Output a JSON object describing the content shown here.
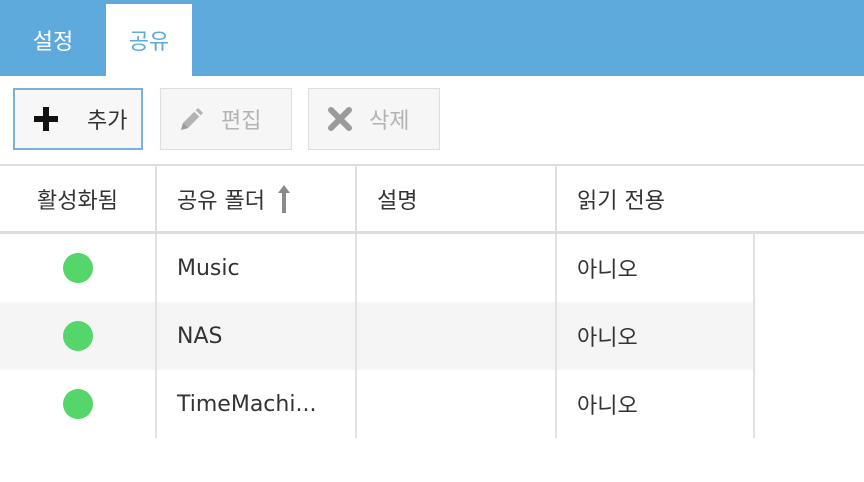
{
  "tabs": [
    {
      "label": "설정"
    },
    {
      "label": "공유"
    }
  ],
  "toolbar": {
    "add_label": "추가",
    "edit_label": "편집",
    "delete_label": "삭제"
  },
  "table": {
    "columns": [
      "활성화됨",
      "공유 폴더",
      "설명",
      "읽기 전용"
    ],
    "sorted_column": "공유 폴더",
    "sort_direction": "ascending",
    "rows": [
      {
        "enabled": true,
        "folder": "Music",
        "description": "",
        "readonly": "아니오"
      },
      {
        "enabled": true,
        "folder": "NAS",
        "description": "",
        "readonly": "아니오"
      },
      {
        "enabled": true,
        "folder": "TimeMachi...",
        "description": "",
        "readonly": "아니오"
      }
    ]
  },
  "colors": {
    "topbar": "#5eaadc",
    "enabled_dot": "#55d66b",
    "add_border": "#7ab0dc"
  },
  "icons": {
    "add": "plus-icon",
    "edit": "pencil-icon",
    "delete": "x-icon",
    "sort": "arrow-up-icon"
  }
}
